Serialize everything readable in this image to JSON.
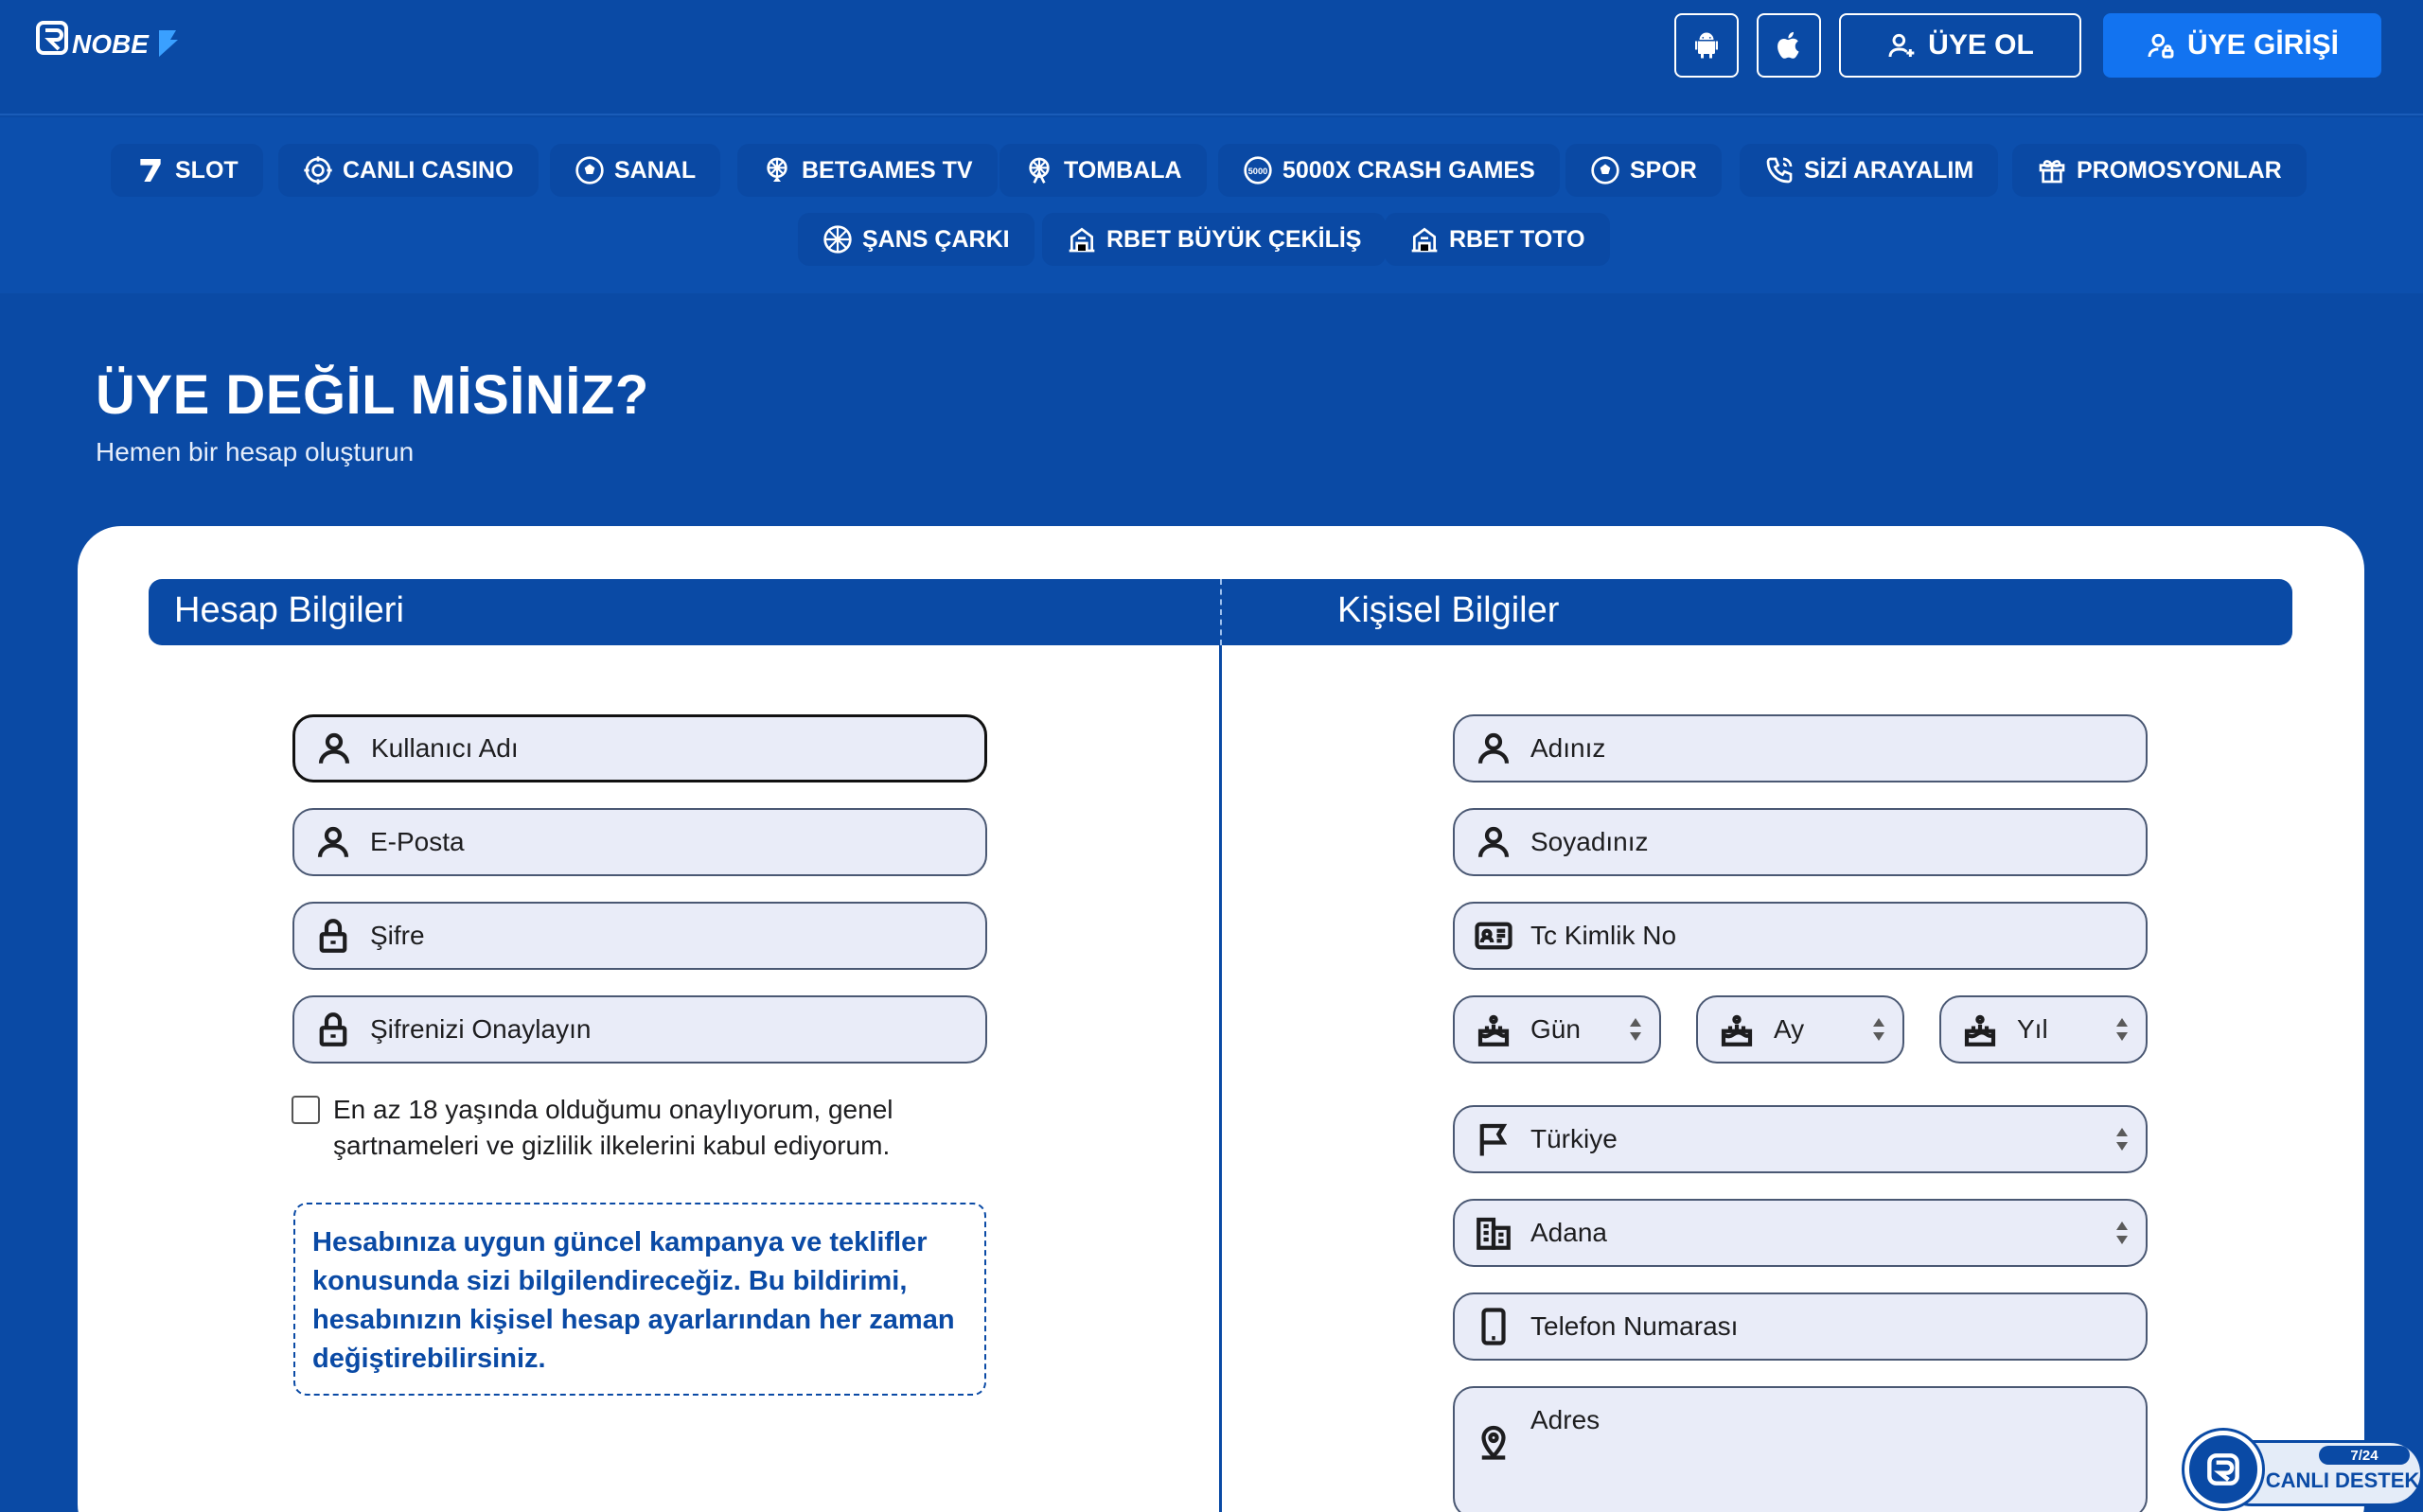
{
  "header": {
    "brand": "RINOBET",
    "register_label": "ÜYE OL",
    "login_label": "ÜYE GİRİŞİ"
  },
  "nav": {
    "row1": [
      {
        "label": "SLOT",
        "icon": "seven-icon"
      },
      {
        "label": "CANLI CASINO",
        "icon": "casino-chip-icon"
      },
      {
        "label": "SANAL",
        "icon": "soccer-ball-icon"
      },
      {
        "label": "BETGAMES TV",
        "icon": "wheel-icon"
      },
      {
        "label": "TOMBALA",
        "icon": "ferris-wheel-icon"
      },
      {
        "label": "5000X CRASH GAMES",
        "icon": "coin-5000-icon"
      },
      {
        "label": "SPOR",
        "icon": "soccer-ball-icon"
      },
      {
        "label": "SİZİ ARAYALIM",
        "icon": "phone-call-icon"
      },
      {
        "label": "PROMOSYONLAR",
        "icon": "gift-icon"
      }
    ],
    "row2": [
      {
        "label": "ŞANS ÇARKI",
        "icon": "wheel-icon"
      },
      {
        "label": "RBET BÜYÜK ÇEKİLİŞ",
        "icon": "ticket-icon"
      },
      {
        "label": "RBET TOTO",
        "icon": "ticket-icon"
      }
    ]
  },
  "hero": {
    "title": "ÜYE DEĞİL MİSİNİZ?",
    "subtitle": "Hemen bir hesap oluşturun"
  },
  "form": {
    "account_section": "Hesap Bilgileri",
    "personal_section": "Kişisel Bilgiler",
    "account_fields": {
      "username": "Kullanıcı Adı",
      "email": "E-Posta",
      "password": "Şifre",
      "password_confirm": "Şifrenizi Onaylayın"
    },
    "personal_fields": {
      "first_name": "Adınız",
      "last_name": "Soyadınız",
      "tc_no": "Tc Kimlik No",
      "day": "Gün",
      "month": "Ay",
      "year": "Yıl",
      "country": "Türkiye",
      "city": "Adana",
      "phone": "Telefon Numarası",
      "address": "Adres"
    },
    "terms_text": "En az 18 yaşında olduğumu onaylıyorum, genel şartnameleri ve gizlilik ilkelerini kabul ediyorum.",
    "notice_text": "Hesabınıza uygun güncel kampanya ve teklifler konusunda sizi bilgilendireceğiz. Bu bildirimi, hesabınızın kişisel hesap ayarlarından her zaman değiştirebilirsiniz."
  },
  "chat": {
    "badge": "7/24",
    "label": "CANLI DESTEK"
  },
  "colors": {
    "primary": "#0a4aa5",
    "accent": "#1273f0",
    "field_bg": "#e9ecf8"
  }
}
